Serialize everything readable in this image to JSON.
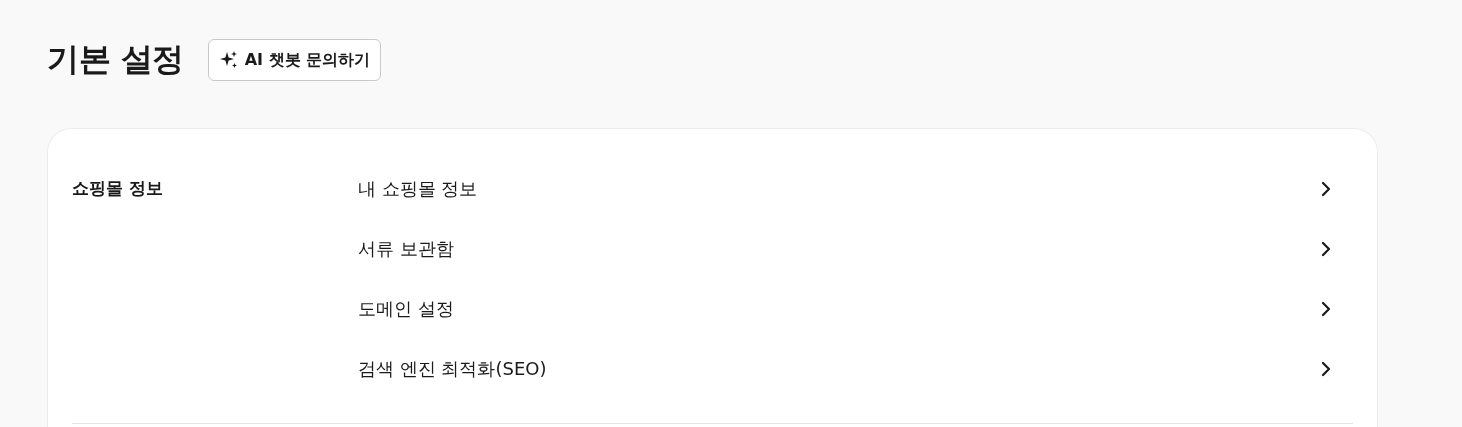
{
  "page_title": "기본 설정",
  "ai_button": {
    "label": "AI 챗봇 문의하기"
  },
  "sections": [
    {
      "title": "쇼핑몰 정보",
      "items": [
        {
          "label": "내 쇼핑몰 정보"
        },
        {
          "label": "서류 보관함"
        },
        {
          "label": "도메인 설정"
        },
        {
          "label": "검색 엔진 최적화(SEO)"
        }
      ]
    }
  ]
}
